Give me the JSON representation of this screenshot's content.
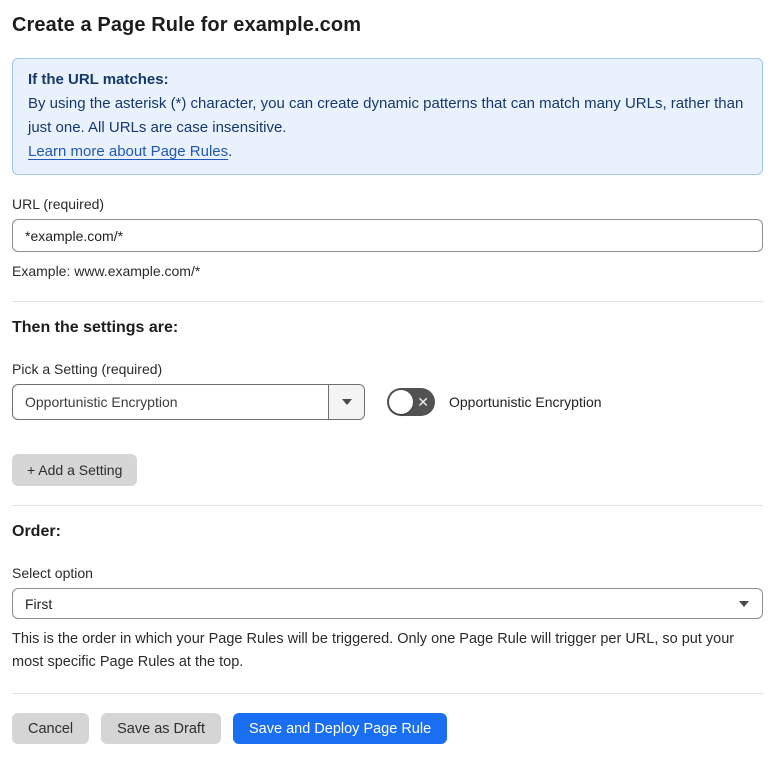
{
  "page": {
    "title": "Create a Page Rule for example.com"
  },
  "info_box": {
    "heading": "If the URL matches:",
    "body": "By using the asterisk (*) character, you can create dynamic patterns that can match many URLs, rather than just one. All URLs are case insensitive.",
    "link_label": "Learn more about Page Rules",
    "link_suffix": "."
  },
  "url_section": {
    "label": "URL (required)",
    "value": "*example.com/*",
    "helper": "Example: www.example.com/*"
  },
  "settings_section": {
    "heading": "Then the settings are:",
    "picker_label": "Pick a Setting (required)",
    "selected_setting": "Opportunistic Encryption",
    "toggle": {
      "state": "off",
      "icon": "✕",
      "label": "Opportunistic Encryption"
    },
    "add_button_label": "+ Add a Setting"
  },
  "order_section": {
    "heading": "Order:",
    "select_label": "Select option",
    "selected_option": "First",
    "helper": "This is the order in which your Page Rules will be triggered. Only one Page Rule will trigger per URL, so put your most specific Page Rules at the top."
  },
  "footer": {
    "cancel_label": "Cancel",
    "save_draft_label": "Save as Draft",
    "save_deploy_label": "Save and Deploy Page Rule"
  },
  "colors": {
    "accent_blue": "#1a6ef2",
    "info_bg": "#e9f2fc",
    "info_border": "#a3c6ec",
    "info_text": "#17386b",
    "toggle_off": "#525252",
    "button_gray": "#d5d5d5"
  }
}
